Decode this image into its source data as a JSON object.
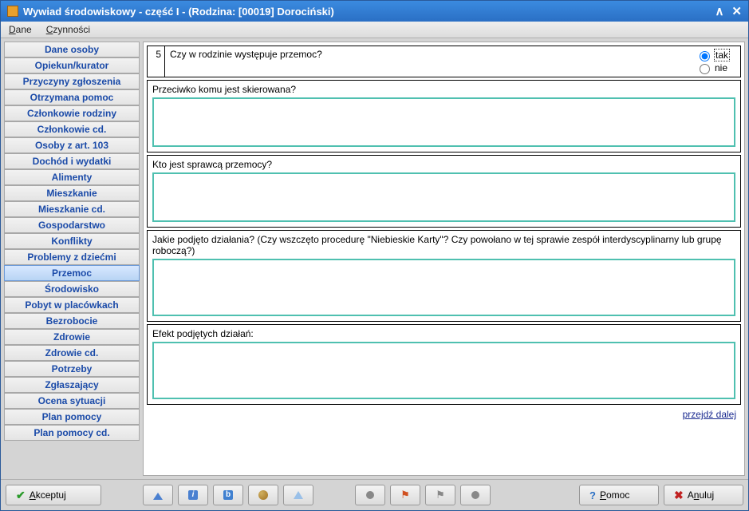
{
  "window": {
    "title": "Wywiad środowiskowy - część I - (Rodzina: [00019] Dorociński)"
  },
  "menu": {
    "dane": "Dane",
    "czynnosci": "Czynności"
  },
  "sidebar": {
    "items": [
      "Dane osoby",
      "Opiekun/kurator",
      "Przyczyny zgłoszenia",
      "Otrzymana pomoc",
      "Członkowie rodziny",
      "Członkowie cd.",
      "Osoby z art. 103",
      "Dochód i wydatki",
      "Alimenty",
      "Mieszkanie",
      "Mieszkanie cd.",
      "Gospodarstwo",
      "Konflikty",
      "Problemy z dziećmi",
      "Przemoc",
      "Środowisko",
      "Pobyt w placówkach",
      "Bezrobocie",
      "Zdrowie",
      "Zdrowie cd.",
      "Potrzeby",
      "Zgłaszający",
      "Ocena sytuacji",
      "Plan pomocy",
      "Plan pomocy cd."
    ],
    "activeIndex": 14
  },
  "main": {
    "qnum": "5",
    "question": "Czy w rodzinie występuje przemoc?",
    "opt_yes": "tak",
    "opt_no": "nie",
    "s1_label": "Przeciwko komu jest skierowana?",
    "s1_value": "",
    "s2_label": "Kto jest sprawcą przemocy?",
    "s2_value": "",
    "s3_label": "Jakie podjęto działania? (Czy wszczęto procedurę \"Niebieskie Karty\"? Czy powołano w tej sprawie zespół interdyscyplinarny lub grupę roboczą?)",
    "s3_value": "",
    "s4_label": "Efekt podjętych działań:",
    "s4_value": "",
    "next": "przejdź dalej"
  },
  "footer": {
    "accept": "Akceptuj",
    "help": "Pomoc",
    "cancel": "Anuluj"
  }
}
